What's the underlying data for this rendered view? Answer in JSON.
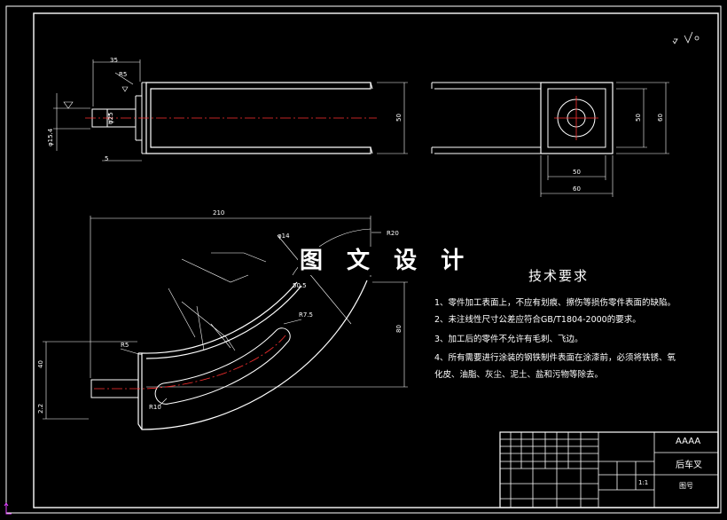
{
  "watermark": "图 文 设 计",
  "tech_requirements": {
    "title": "技术要求",
    "notes": [
      "1、零件加工表面上，不应有划痕、擦伤等损伤零件表面的缺陷。",
      "2、未注线性尺寸公差应符合GB/T1804-2000的要求。",
      "3、加工后的零件不允许有毛刺、飞边。",
      "4、所有需要进行涂装的钢铁制件表面在涂漆前，必须将铁锈、氧",
      "化皮、油脂、灰尘、泥土、盐和污物等除去。"
    ]
  },
  "dimensions": {
    "top_view_35": "35",
    "top_view_r5": "R5",
    "top_view_phi25": "φ25",
    "top_view_5": "5",
    "top_view_50": "50",
    "top_view_phi": "φ15.4",
    "side_view_50_h": "50",
    "side_view_60_h": "60",
    "side_view_50_w": "50",
    "side_view_60_w": "60",
    "main_210": "210",
    "main_r20": "R20",
    "main_phi": "φ14",
    "main_r75": "R7.5",
    "main_r5": "R5",
    "main_r10": "R10",
    "main_80": "80",
    "main_40": "40",
    "main_22": "2.2",
    "main_505": "50.5"
  },
  "title_block": {
    "company": "AAAA",
    "part_name": "后车叉",
    "drawing_no_label": "图号",
    "scale_value": "1:1"
  },
  "colors": {
    "background": "#000000",
    "line": "#ffffff",
    "centerline": "#ff3030",
    "accent": "#e040ff"
  }
}
